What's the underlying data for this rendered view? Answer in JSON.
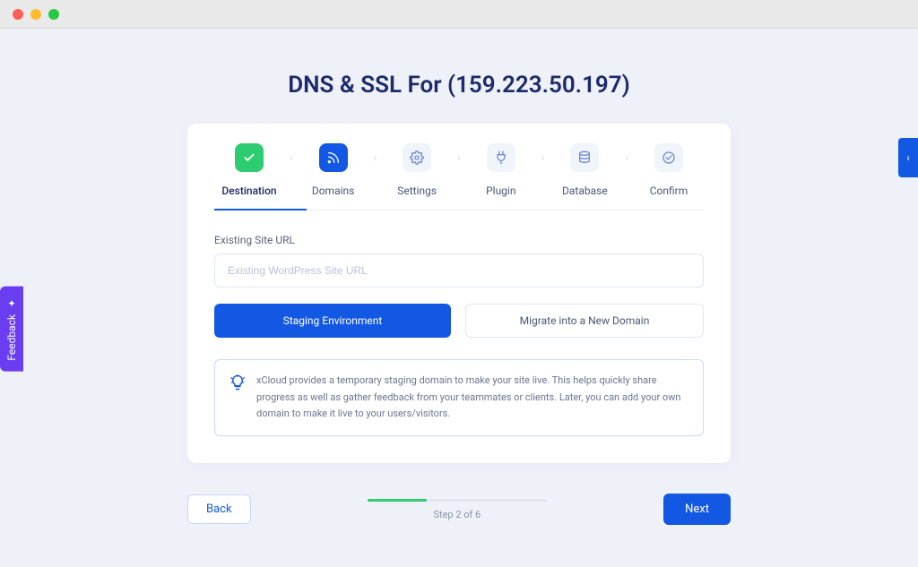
{
  "header": {
    "title": "DNS & SSL For (159.223.50.197)"
  },
  "stepper": {
    "steps": [
      {
        "label": "Destination",
        "state": "done"
      },
      {
        "label": "Domains",
        "state": "active"
      },
      {
        "label": "Settings",
        "state": "idle"
      },
      {
        "label": "Plugin",
        "state": "idle"
      },
      {
        "label": "Database",
        "state": "idle"
      },
      {
        "label": "Confirm",
        "state": "idle"
      }
    ]
  },
  "form": {
    "url_label": "Existing Site URL",
    "url_placeholder": "Existing WordPress Site URL",
    "url_value": ""
  },
  "tabs": {
    "staging": "Staging Environment",
    "migrate": "Migrate into a New Domain"
  },
  "info": {
    "text": "xCloud provides a temporary staging domain to make your site live. This helps quickly share progress as well as gather feedback from your teammates or clients. Later, you can add your own domain to make it live to your users/visitors."
  },
  "footer": {
    "back": "Back",
    "next": "Next",
    "progress_label": "Step 2 of 6"
  },
  "sidebar": {
    "feedback": "Feedback"
  }
}
